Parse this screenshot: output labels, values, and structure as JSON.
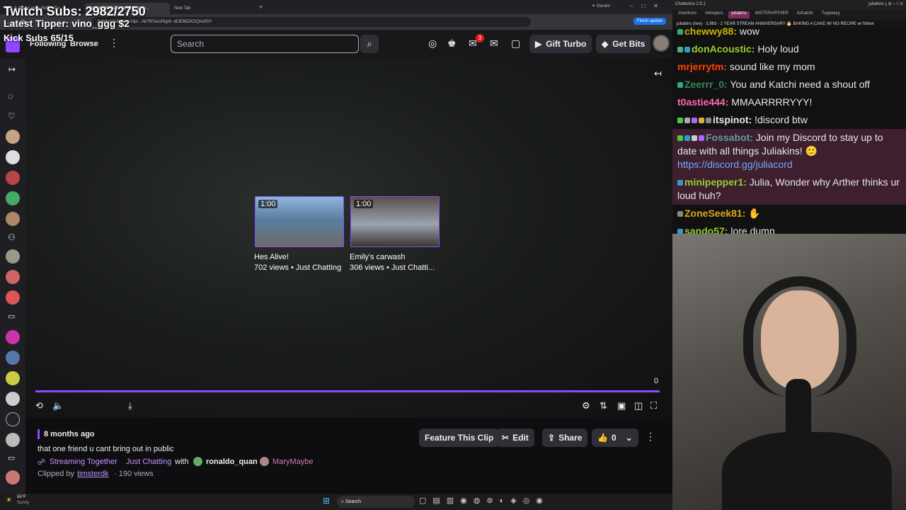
{
  "overlay": {
    "subs_line": "Twitch Subs: 2982/2750",
    "tipper_line": "Latest Tipper: vino_ggg  $2",
    "kick_line": "Kick Subs 65/15"
  },
  "browser": {
    "tabs": [
      "Julia & Arther goes thrift... Tw",
      "that one friend u cant bring ou...",
      "New Tab"
    ],
    "gemini_label": "Gemini",
    "url": "twitch.tv/juliakins/clip/...AbTBTacoRight--dtJE6BZKDQho8SY",
    "finish_update": "Finish update"
  },
  "twitch": {
    "nav": {
      "following": "Following",
      "browse": "Browse",
      "search_placeholder": "Search",
      "notif_count": "3",
      "gift_turbo": "Gift Turbo",
      "get_bits": "Get Bits"
    },
    "video": {
      "recommended": [
        {
          "duration": "1:00",
          "title": "Hes Alive!",
          "meta": "702 views • Just Chatting"
        },
        {
          "duration": "1:00",
          "title": "Emily's carwash",
          "meta": "306 views • Just Chatti..."
        }
      ],
      "counter": "0",
      "progress_fraction": 1.0
    },
    "clip": {
      "age": "8 months ago",
      "title": "that one friend u cant bring out in public",
      "streaming_together": "Streaming Together",
      "category": "Just Chatting",
      "with": "with",
      "collab1": "ronaldo_quan",
      "collab2": "MaryMaybe",
      "clipped_by_label": "Clipped by",
      "clipper": "timsterdk",
      "views": "· 190 views",
      "feature_btn": "Feature This Clip",
      "edit_btn": "Edit",
      "share_btn": "Share",
      "likes": "0"
    }
  },
  "taskbar": {
    "weather_temp": "55°F",
    "weather_cond": "Sunny",
    "search": "Search"
  },
  "chatterino": {
    "title": "Chatterino 2.5.1",
    "user": "juliakins",
    "tabs": [
      "/mentions",
      "/whispers",
      "juliakins",
      "MISTERARTHER",
      "itsKatchi",
      "Tuppeeyy"
    ],
    "header": "juliakins (live) - 3,963 - 2 YEAR STREAM ANNIVERSARY 🎂 BAKING A CAKE W/ NO RECIPE w/ follow",
    "messages": [
      {
        "user": "chewwy88:",
        "text": "wow",
        "color": "#c8b400"
      },
      {
        "user": "donAcoustic:",
        "text": "Holy loud",
        "color": "#9acd32"
      },
      {
        "user": "mrjerrytm:",
        "text": "sound like my mom",
        "color": "#ff4500"
      },
      {
        "user": "Zeerrr_0:",
        "text": "You and Katchi need a shout off",
        "color": "#2e8b57"
      },
      {
        "user": "t0astie444:",
        "text": "MMAARRRRYYY!",
        "color": "#ff69b4"
      },
      {
        "user": "itspinot:",
        "text": "!discord btw",
        "color": "#e8e8e8"
      },
      {
        "user": "Fossabot:",
        "text": "Join my Discord to stay up to date with all things Juliakins!",
        "link": "https://discord.gg/juliacord",
        "color": "#5f9ea0"
      },
      {
        "user": "minipepper1:",
        "text": "Julia, Wonder why Arther thinks ur loud huh?",
        "color": "#9acd32"
      },
      {
        "user": "ZoneSeek81:",
        "text": "",
        "color": "#daa520"
      },
      {
        "user": "sando57:",
        "text": "lore dump",
        "color": "#9acd32"
      }
    ]
  },
  "colors": {
    "accent": "#9147ff",
    "bg": "#0e0e10"
  }
}
